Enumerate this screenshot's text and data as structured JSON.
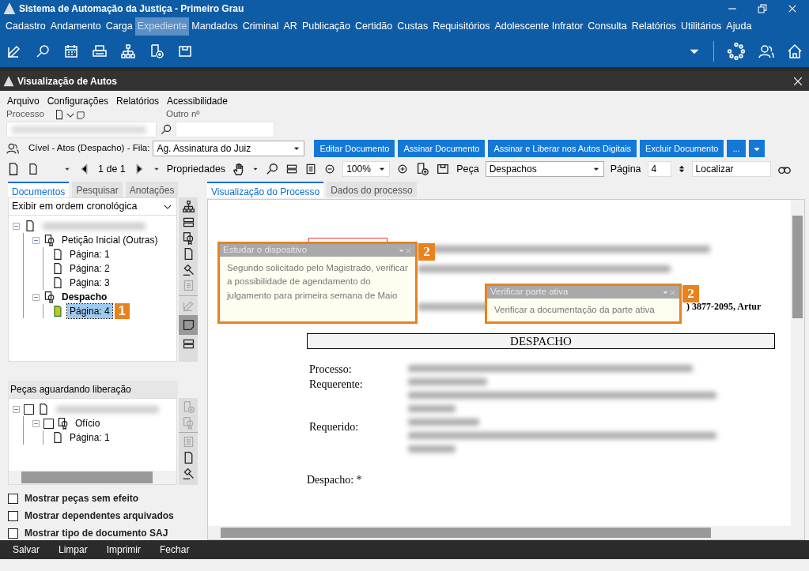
{
  "window": {
    "title": "Sistema de Automação da Justiça - Primeiro Grau"
  },
  "main_menu": [
    {
      "label": "Cadastro",
      "selected": false
    },
    {
      "label": "Andamento",
      "selected": false
    },
    {
      "label": "Carga",
      "selected": false
    },
    {
      "label": "Expediente",
      "selected": true
    },
    {
      "label": "Mandados",
      "selected": false
    },
    {
      "label": "Criminal",
      "selected": false
    },
    {
      "label": "AR",
      "selected": false
    },
    {
      "label": "Publicação",
      "selected": false
    },
    {
      "label": "Certidão",
      "selected": false
    },
    {
      "label": "Custas",
      "selected": false
    },
    {
      "label": "Requisitórios",
      "selected": false
    },
    {
      "label": "Adolescente Infrator",
      "selected": false
    },
    {
      "label": "Consulta",
      "selected": false
    },
    {
      "label": "Relatórios",
      "selected": false
    },
    {
      "label": "Utilitários",
      "selected": false
    },
    {
      "label": "Ajuda",
      "selected": false
    }
  ],
  "dialog": {
    "title": "Visualização de Autos"
  },
  "dialog_menu": [
    "Arquivo",
    "Configurações",
    "Relatórios",
    "Acessibilidade"
  ],
  "process_search": {
    "processo_label": "Processo",
    "outro_label": "Outro nº"
  },
  "queue": {
    "label": "Cível - Atos (Despacho) - Fila:",
    "value": "Ag. Assinatura do Juiz"
  },
  "action_buttons": [
    "Editar Documento",
    "Assinar Documento",
    "Assinar e Liberar nos Autos Digitais",
    "Excluir Documento",
    "..."
  ],
  "viewer_toolbar": {
    "page_count": "1 de 1",
    "properties": "Propriedades",
    "zoom": "100%",
    "peca_label": "Peça",
    "peca_value": "Despachos",
    "pagina_label": "Página",
    "pagina_value": "4",
    "search_value": "Localizar"
  },
  "left_tabs": [
    {
      "label": "Documentos",
      "selected": true
    },
    {
      "label": "Pesquisar",
      "selected": false
    },
    {
      "label": "Anotações",
      "selected": false
    }
  ],
  "order_select": "Exibir em ordem cronológica",
  "tree": [
    {
      "kind": "process",
      "expanded": true,
      "children": [
        {
          "kind": "document",
          "label": "Petição Inicial (Outras)",
          "active": false,
          "expanded": true,
          "children": [
            {
              "kind": "page",
              "label": "Página: 1",
              "selected": false
            },
            {
              "kind": "page",
              "label": "Página: 2",
              "selected": false
            },
            {
              "kind": "page",
              "label": "Página: 3",
              "selected": false
            }
          ]
        },
        {
          "kind": "document",
          "label": "Despacho",
          "active": true,
          "expanded": true,
          "children": [
            {
              "kind": "page",
              "label": "Página: 4",
              "selected": true,
              "callout": "1"
            }
          ]
        }
      ]
    }
  ],
  "pending": {
    "title": "Peças aguardando liberação",
    "tree": [
      {
        "kind": "process",
        "expanded": true,
        "checked": false,
        "children": [
          {
            "kind": "document",
            "label": "Ofício",
            "expanded": true,
            "checked": false,
            "children": [
              {
                "kind": "page",
                "label": "Página: 1"
              }
            ]
          }
        ]
      }
    ]
  },
  "options": [
    {
      "label": "Mostrar peças sem efeito",
      "checked": false
    },
    {
      "label": "Mostrar dependentes arquivados",
      "checked": false
    },
    {
      "label": "Mostrar tipo de documento SAJ",
      "checked": false
    }
  ],
  "viewer_tabs": [
    {
      "label": "Visualização do Processo",
      "selected": true
    },
    {
      "label": "Dados do processo",
      "selected": false
    }
  ],
  "document": {
    "phone_fragment": ") 3877-2095, Artur",
    "heading": "DESPACHO",
    "fields": [
      "Processo:",
      "Requerente:",
      "Requerido:"
    ],
    "despacho_label": "Despacho: *"
  },
  "notes": [
    {
      "title": "Estudar o dispositivo",
      "text": "Segundo solicitado pelo Magistrado, verificar a possibilidade de agendamento do julgamento para primeira semana de Maio",
      "callout": "2"
    },
    {
      "title": "Verificar parte ativa",
      "text": "Verificar a documentação da parte ativa",
      "callout": "2"
    }
  ],
  "footer": [
    "Salvar",
    "Limpar",
    "Imprimir",
    "Fechar"
  ]
}
